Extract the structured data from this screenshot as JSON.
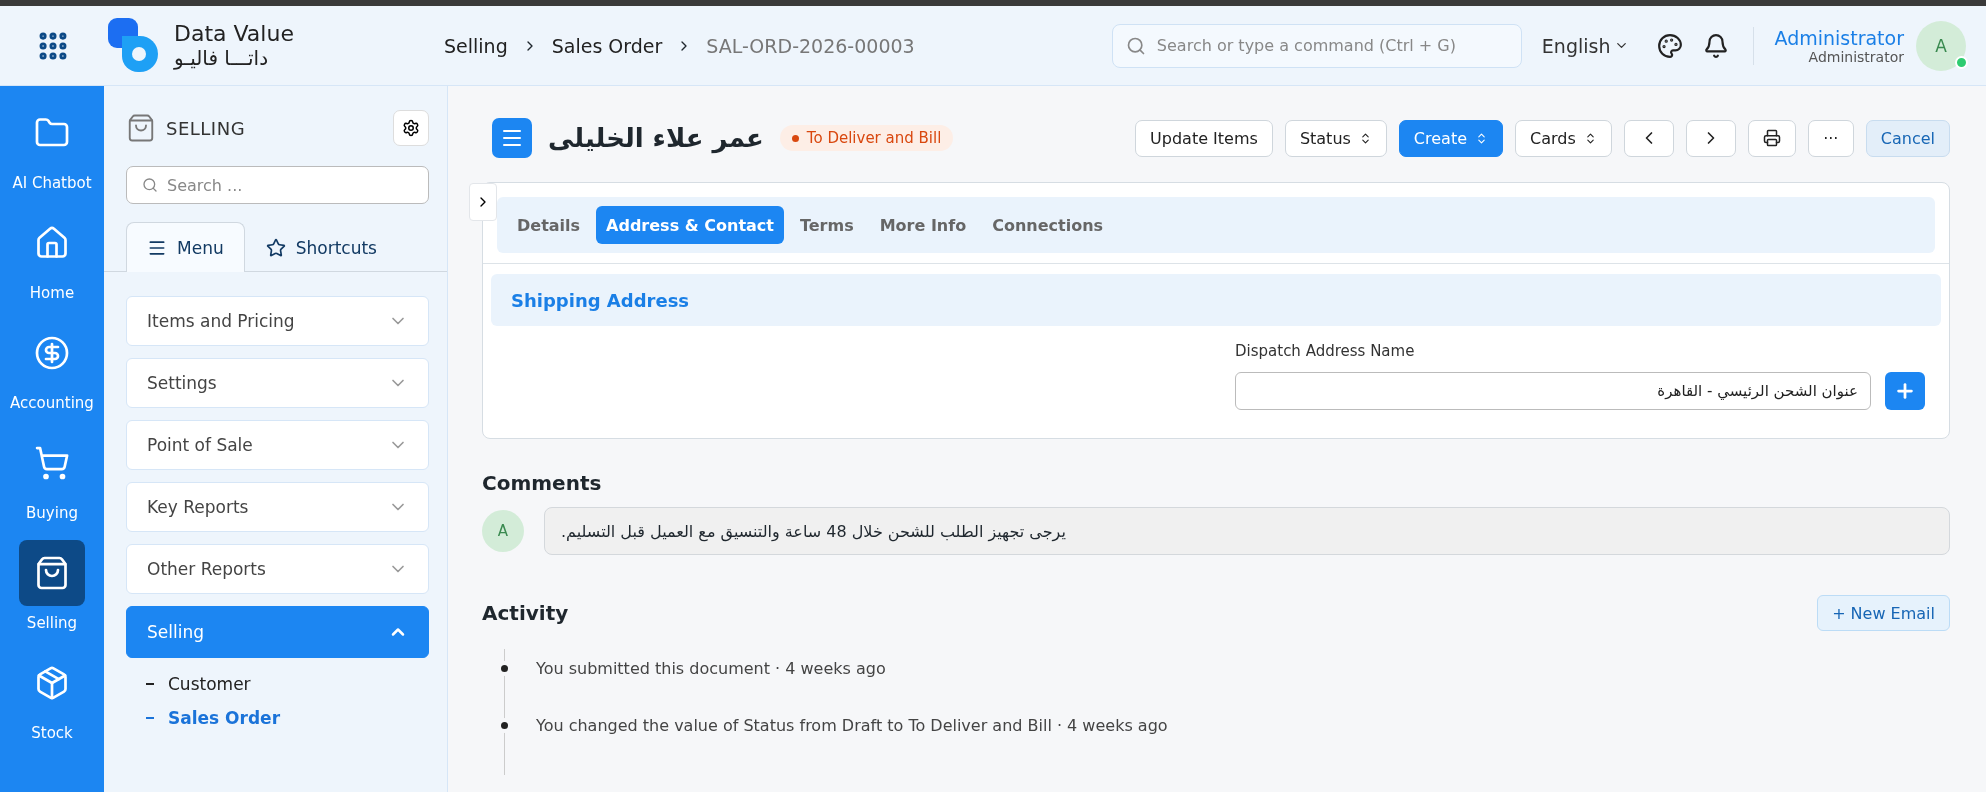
{
  "topbar": {
    "logo": {
      "name": "Data Value",
      "arabic_name": "داتـــا فاليـو"
    },
    "breadcrumbs": [
      "Selling",
      "Sales Order",
      "SAL-ORD-2026-00003"
    ],
    "search": {
      "placeholder": "Search or type a command (Ctrl + G)"
    },
    "language": "English",
    "user": {
      "name": "Administrator",
      "role": "Administrator",
      "initial": "A",
      "online": true
    }
  },
  "rail": [
    {
      "kind": "folder",
      "label": "AI Chatbot",
      "selected": false
    },
    {
      "kind": "home",
      "label": "Home",
      "selected": false
    },
    {
      "kind": "dollar",
      "label": "Accounting",
      "selected": false
    },
    {
      "kind": "cart",
      "label": "Buying",
      "selected": false
    },
    {
      "kind": "bag",
      "label": "Selling",
      "selected": true
    },
    {
      "kind": "box",
      "label": "Stock",
      "selected": false
    }
  ],
  "sidebar": {
    "title": "SELLING",
    "search": {
      "placeholder": "Search ..."
    },
    "tabs": [
      {
        "kind": "menu",
        "label": "Menu",
        "selected": true
      },
      {
        "kind": "star",
        "label": "Shortcuts",
        "selected": false
      }
    ],
    "groups": [
      {
        "label": "Items and Pricing",
        "expanded": false
      },
      {
        "label": "Settings",
        "expanded": false
      },
      {
        "label": "Point of Sale",
        "expanded": false
      },
      {
        "label": "Key Reports",
        "expanded": false
      },
      {
        "label": "Other Reports",
        "expanded": false
      },
      {
        "label": "Selling",
        "expanded": true,
        "children": [
          {
            "label": "Customer",
            "selected": false
          },
          {
            "label": "Sales Order",
            "selected": true
          }
        ]
      }
    ]
  },
  "document": {
    "title": "عمر علاء الخليلى",
    "status": {
      "label": "To Deliver and Bill",
      "color": "#d9480f"
    },
    "actions": [
      {
        "kind": "plain",
        "label": "Update Items"
      },
      {
        "kind": "select",
        "label": "Status"
      },
      {
        "kind": "primary-select",
        "label": "Create"
      },
      {
        "kind": "select",
        "label": "Cards"
      },
      {
        "kind": "prev"
      },
      {
        "kind": "next"
      },
      {
        "kind": "print"
      },
      {
        "kind": "more",
        "label": "···"
      },
      {
        "kind": "cancel",
        "label": "Cancel"
      }
    ],
    "tabs": [
      {
        "label": "Details",
        "selected": false
      },
      {
        "label": "Address & Contact",
        "selected": true
      },
      {
        "label": "Terms",
        "selected": false
      },
      {
        "label": "More Info",
        "selected": false
      },
      {
        "label": "Connections",
        "selected": false
      }
    ],
    "section": {
      "title": "Shipping Address",
      "field": {
        "label": "Dispatch Address Name",
        "value": "عنوان الشحن الرئيسي - القاهرة"
      }
    }
  },
  "comments": {
    "title": "Comments",
    "items": [
      {
        "initial": "A",
        "text": "يرجى تجهيز الطلب للشحن خلال 48 ساعة والتنسيق مع العميل قبل التسليم."
      }
    ]
  },
  "activity": {
    "title": "Activity",
    "new_email": "+ New Email",
    "items": [
      "You submitted this document · 4 weeks ago",
      "You changed the value of Status from Draft to To Deliver and Bill · 4 weeks ago"
    ]
  }
}
